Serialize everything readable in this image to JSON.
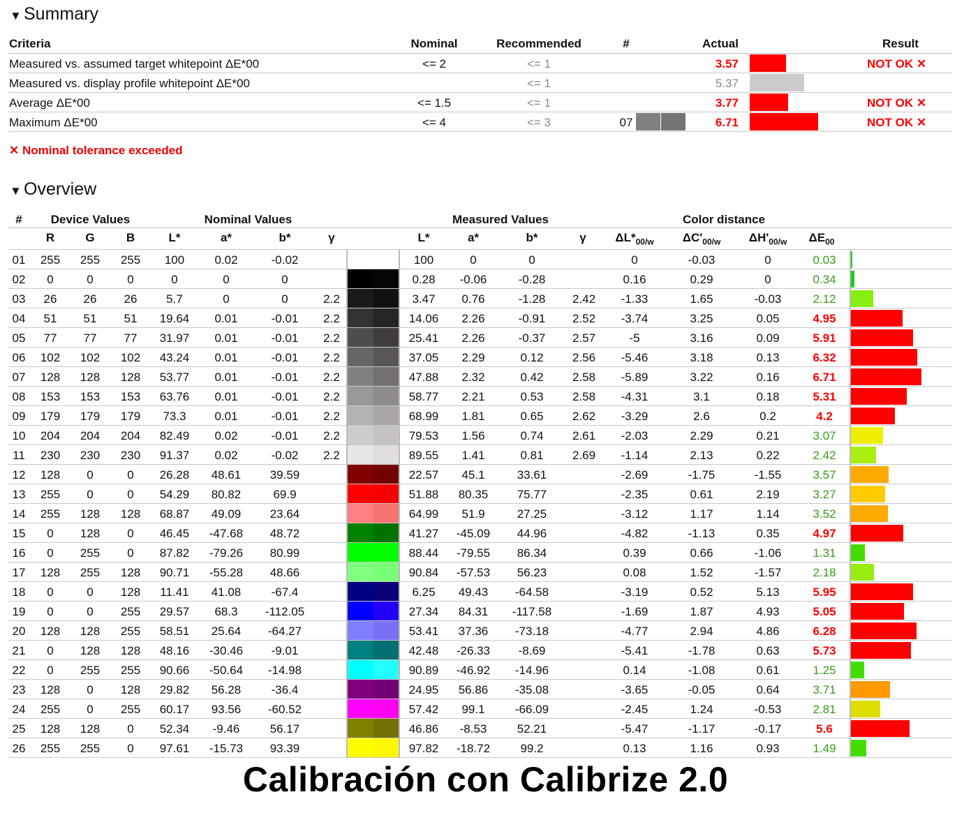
{
  "summary": {
    "title": "Summary",
    "headers": {
      "criteria": "Criteria",
      "nominal": "Nominal",
      "recommended": "Recommended",
      "hash": "#",
      "actual": "Actual",
      "result": "Result"
    },
    "rows": [
      {
        "criteria": "Measured vs. assumed target whitepoint ΔE*00",
        "nominal": "<= 2",
        "recommended": "<= 1",
        "hash": "",
        "actual": "3.57",
        "result": "NOT OK ✕",
        "status": "fail",
        "bar_color": "#ff0000"
      },
      {
        "criteria": "Measured vs. display profile whitepoint ΔE*00",
        "nominal": "",
        "recommended": "<= 1",
        "hash": "",
        "actual": "5.37",
        "result": "",
        "status": "info",
        "bar_color": "#cccccc"
      },
      {
        "criteria": "Average ΔE*00",
        "nominal": "<= 1.5",
        "recommended": "<= 1",
        "hash": "",
        "actual": "3.77",
        "result": "NOT OK ✕",
        "status": "fail",
        "bar_color": "#ff0000"
      },
      {
        "criteria": "Maximum ΔE*00",
        "nominal": "<= 4",
        "recommended": "<= 3",
        "hash": "07",
        "actual": "6.71",
        "result": "NOT OK ✕",
        "status": "fail",
        "bar_color": "#ff0000"
      }
    ],
    "fail_note": "✕ Nominal tolerance exceeded"
  },
  "overview": {
    "title": "Overview",
    "groups": {
      "hash": "#",
      "device": "Device Values",
      "nominal": "Nominal Values",
      "measured": "Measured Values",
      "distance": "Color distance"
    },
    "cols": {
      "r": "R",
      "g": "G",
      "b": "B",
      "nl": "L*",
      "na": "a*",
      "nb": "b*",
      "ng": "γ",
      "ml": "L*",
      "ma": "a*",
      "mb": "b*",
      "mg": "γ",
      "dl": "ΔL*",
      "dc": "ΔC'",
      "dh": "ΔH'",
      "de": "ΔE",
      "sub_w": "00/w",
      "sub_00": "00"
    },
    "rows": [
      {
        "n": "01",
        "r": "255",
        "g": "255",
        "b": "255",
        "nl": "100",
        "na": "0.02",
        "nb": "-0.02",
        "ng": "",
        "ml": "100",
        "ma": "0",
        "mb": "0",
        "mg": "",
        "dl": "0",
        "dc": "-0.03",
        "dh": "0",
        "de": "0.03",
        "color": "#ffffff",
        "mcolor": "#ffffff",
        "bar": 0.03,
        "barcolor": "#22cc22"
      },
      {
        "n": "02",
        "r": "0",
        "g": "0",
        "b": "0",
        "nl": "0",
        "na": "0",
        "nb": "0",
        "ng": "",
        "ml": "0.28",
        "ma": "-0.06",
        "mb": "-0.28",
        "mg": "",
        "dl": "0.16",
        "dc": "0.29",
        "dh": "0",
        "de": "0.34",
        "color": "#000000",
        "mcolor": "#050505",
        "bar": 0.34,
        "barcolor": "#22cc22"
      },
      {
        "n": "03",
        "r": "26",
        "g": "26",
        "b": "26",
        "nl": "5.7",
        "na": "0",
        "nb": "0",
        "ng": "2.2",
        "ml": "3.47",
        "ma": "0.76",
        "mb": "-1.28",
        "mg": "2.42",
        "dl": "-1.33",
        "dc": "1.65",
        "dh": "-0.03",
        "de": "2.12",
        "color": "#1a1a1a",
        "mcolor": "#111111",
        "bar": 2.12,
        "barcolor": "#88ee11"
      },
      {
        "n": "04",
        "r": "51",
        "g": "51",
        "b": "51",
        "nl": "19.64",
        "na": "0.01",
        "nb": "-0.01",
        "ng": "2.2",
        "ml": "14.06",
        "ma": "2.26",
        "mb": "-0.91",
        "mg": "2.52",
        "dl": "-3.74",
        "dc": "3.25",
        "dh": "0.05",
        "de": "4.95",
        "color": "#333333",
        "mcolor": "#272426",
        "bar": 4.95,
        "barcolor": "#ff0000"
      },
      {
        "n": "05",
        "r": "77",
        "g": "77",
        "b": "77",
        "nl": "31.97",
        "na": "0.01",
        "nb": "-0.01",
        "ng": "2.2",
        "ml": "25.41",
        "ma": "2.26",
        "mb": "-0.37",
        "mg": "2.57",
        "dl": "-5",
        "dc": "3.16",
        "dh": "0.09",
        "de": "5.91",
        "color": "#4d4d4d",
        "mcolor": "#403c3e",
        "bar": 5.91,
        "barcolor": "#ff0000"
      },
      {
        "n": "06",
        "r": "102",
        "g": "102",
        "b": "102",
        "nl": "43.24",
        "na": "0.01",
        "nb": "-0.01",
        "ng": "2.2",
        "ml": "37.05",
        "ma": "2.29",
        "mb": "0.12",
        "mg": "2.56",
        "dl": "-5.46",
        "dc": "3.18",
        "dh": "0.13",
        "de": "6.32",
        "color": "#666666",
        "mcolor": "#5a5658",
        "bar": 6.32,
        "barcolor": "#ff0000"
      },
      {
        "n": "07",
        "r": "128",
        "g": "128",
        "b": "128",
        "nl": "53.77",
        "na": "0.01",
        "nb": "-0.01",
        "ng": "2.2",
        "ml": "47.88",
        "ma": "2.32",
        "mb": "0.42",
        "mg": "2.58",
        "dl": "-5.89",
        "dc": "3.22",
        "dh": "0.16",
        "de": "6.71",
        "color": "#808080",
        "mcolor": "#747072",
        "bar": 6.71,
        "barcolor": "#ff0000"
      },
      {
        "n": "08",
        "r": "153",
        "g": "153",
        "b": "153",
        "nl": "63.76",
        "na": "0.01",
        "nb": "-0.01",
        "ng": "2.2",
        "ml": "58.77",
        "ma": "2.21",
        "mb": "0.53",
        "mg": "2.58",
        "dl": "-4.31",
        "dc": "3.1",
        "dh": "0.18",
        "de": "5.31",
        "color": "#999999",
        "mcolor": "#8f8b8c",
        "bar": 5.31,
        "barcolor": "#ff0000"
      },
      {
        "n": "09",
        "r": "179",
        "g": "179",
        "b": "179",
        "nl": "73.3",
        "na": "0.01",
        "nb": "-0.01",
        "ng": "2.2",
        "ml": "68.99",
        "ma": "1.81",
        "mb": "0.65",
        "mg": "2.62",
        "dl": "-3.29",
        "dc": "2.6",
        "dh": "0.2",
        "de": "4.2",
        "color": "#b3b3b3",
        "mcolor": "#aaa6a7",
        "bar": 4.2,
        "barcolor": "#ff0000"
      },
      {
        "n": "10",
        "r": "204",
        "g": "204",
        "b": "204",
        "nl": "82.49",
        "na": "0.02",
        "nb": "-0.01",
        "ng": "2.2",
        "ml": "79.53",
        "ma": "1.56",
        "mb": "0.74",
        "mg": "2.61",
        "dl": "-2.03",
        "dc": "2.29",
        "dh": "0.21",
        "de": "3.07",
        "color": "#cccccc",
        "mcolor": "#c6c2c3",
        "bar": 3.07,
        "barcolor": "#eeee00"
      },
      {
        "n": "11",
        "r": "230",
        "g": "230",
        "b": "230",
        "nl": "91.37",
        "na": "0.02",
        "nb": "-0.02",
        "ng": "2.2",
        "ml": "89.55",
        "ma": "1.41",
        "mb": "0.81",
        "mg": "2.69",
        "dl": "-1.14",
        "dc": "2.13",
        "dh": "0.22",
        "de": "2.42",
        "color": "#e6e6e6",
        "mcolor": "#e1dddd",
        "bar": 2.42,
        "barcolor": "#aaee11"
      },
      {
        "n": "12",
        "r": "128",
        "g": "0",
        "b": "0",
        "nl": "26.28",
        "na": "48.61",
        "nb": "39.59",
        "ng": "",
        "ml": "22.57",
        "ma": "45.1",
        "mb": "33.61",
        "mg": "",
        "dl": "-2.69",
        "dc": "-1.75",
        "dh": "-1.55",
        "de": "3.57",
        "color": "#800000",
        "mcolor": "#720000",
        "bar": 3.57,
        "barcolor": "#ffaa00"
      },
      {
        "n": "13",
        "r": "255",
        "g": "0",
        "b": "0",
        "nl": "54.29",
        "na": "80.82",
        "nb": "69.9",
        "ng": "",
        "ml": "51.88",
        "ma": "80.35",
        "mb": "75.77",
        "mg": "",
        "dl": "-2.35",
        "dc": "0.61",
        "dh": "2.19",
        "de": "3.27",
        "color": "#ff0000",
        "mcolor": "#f80000",
        "bar": 3.27,
        "barcolor": "#ffcc00"
      },
      {
        "n": "14",
        "r": "255",
        "g": "128",
        "b": "128",
        "nl": "68.87",
        "na": "49.09",
        "nb": "23.64",
        "ng": "",
        "ml": "64.99",
        "ma": "51.9",
        "mb": "27.25",
        "mg": "",
        "dl": "-3.12",
        "dc": "1.17",
        "dh": "1.14",
        "de": "3.52",
        "color": "#ff8080",
        "mcolor": "#f87272",
        "bar": 3.52,
        "barcolor": "#ffaa00"
      },
      {
        "n": "15",
        "r": "0",
        "g": "128",
        "b": "0",
        "nl": "46.45",
        "na": "-47.68",
        "nb": "48.72",
        "ng": "",
        "ml": "41.27",
        "ma": "-45.09",
        "mb": "44.96",
        "mg": "",
        "dl": "-4.82",
        "dc": "-1.13",
        "dh": "0.35",
        "de": "4.97",
        "color": "#008000",
        "mcolor": "#007200",
        "bar": 4.97,
        "barcolor": "#ff0000"
      },
      {
        "n": "16",
        "r": "0",
        "g": "255",
        "b": "0",
        "nl": "87.82",
        "na": "-79.26",
        "nb": "80.99",
        "ng": "",
        "ml": "88.44",
        "ma": "-79.55",
        "mb": "86.34",
        "mg": "",
        "dl": "0.39",
        "dc": "0.66",
        "dh": "-1.06",
        "de": "1.31",
        "color": "#00ff00",
        "mcolor": "#00ff00",
        "bar": 1.31,
        "barcolor": "#44dd00"
      },
      {
        "n": "17",
        "r": "128",
        "g": "255",
        "b": "128",
        "nl": "90.71",
        "na": "-55.28",
        "nb": "48.66",
        "ng": "",
        "ml": "90.84",
        "ma": "-57.53",
        "mb": "56.23",
        "mg": "",
        "dl": "0.08",
        "dc": "1.52",
        "dh": "-1.57",
        "de": "2.18",
        "color": "#80ff80",
        "mcolor": "#7bff77",
        "bar": 2.18,
        "barcolor": "#99ee11"
      },
      {
        "n": "18",
        "r": "0",
        "g": "0",
        "b": "128",
        "nl": "11.41",
        "na": "41.08",
        "nb": "-67.4",
        "ng": "",
        "ml": "6.25",
        "ma": "49.43",
        "mb": "-64.58",
        "mg": "",
        "dl": "-3.19",
        "dc": "0.52",
        "dh": "5.13",
        "de": "5.95",
        "color": "#000080",
        "mcolor": "#0a0077",
        "bar": 5.95,
        "barcolor": "#ff0000"
      },
      {
        "n": "19",
        "r": "0",
        "g": "0",
        "b": "255",
        "nl": "29.57",
        "na": "68.3",
        "nb": "-112.05",
        "ng": "",
        "ml": "27.34",
        "ma": "84.31",
        "mb": "-117.58",
        "mg": "",
        "dl": "-1.69",
        "dc": "1.87",
        "dh": "4.93",
        "de": "5.05",
        "color": "#0000ff",
        "mcolor": "#2200f5",
        "bar": 5.05,
        "barcolor": "#ff0000"
      },
      {
        "n": "20",
        "r": "128",
        "g": "128",
        "b": "255",
        "nl": "58.51",
        "na": "25.64",
        "nb": "-64.27",
        "ng": "",
        "ml": "53.41",
        "ma": "37.36",
        "mb": "-73.18",
        "mg": "",
        "dl": "-4.77",
        "dc": "2.94",
        "dh": "4.86",
        "de": "6.28",
        "color": "#8080ff",
        "mcolor": "#7a70f5",
        "bar": 6.28,
        "barcolor": "#ff0000"
      },
      {
        "n": "21",
        "r": "0",
        "g": "128",
        "b": "128",
        "nl": "48.16",
        "na": "-30.46",
        "nb": "-9.01",
        "ng": "",
        "ml": "42.48",
        "ma": "-26.33",
        "mb": "-8.69",
        "mg": "",
        "dl": "-5.41",
        "dc": "-1.78",
        "dh": "0.63",
        "de": "5.73",
        "color": "#008080",
        "mcolor": "#007072",
        "bar": 5.73,
        "barcolor": "#ff0000"
      },
      {
        "n": "22",
        "r": "0",
        "g": "255",
        "b": "255",
        "nl": "90.66",
        "na": "-50.64",
        "nb": "-14.98",
        "ng": "",
        "ml": "90.89",
        "ma": "-46.92",
        "mb": "-14.96",
        "mg": "",
        "dl": "0.14",
        "dc": "-1.08",
        "dh": "0.61",
        "de": "1.25",
        "color": "#00ffff",
        "mcolor": "#22ffff",
        "bar": 1.25,
        "barcolor": "#44dd00"
      },
      {
        "n": "23",
        "r": "128",
        "g": "0",
        "b": "128",
        "nl": "29.82",
        "na": "56.28",
        "nb": "-36.4",
        "ng": "",
        "ml": "24.95",
        "ma": "56.86",
        "mb": "-35.08",
        "mg": "",
        "dl": "-3.65",
        "dc": "-0.05",
        "dh": "0.64",
        "de": "3.71",
        "color": "#800080",
        "mcolor": "#740074",
        "bar": 3.71,
        "barcolor": "#ff9900"
      },
      {
        "n": "24",
        "r": "255",
        "g": "0",
        "b": "255",
        "nl": "60.17",
        "na": "93.56",
        "nb": "-60.52",
        "ng": "",
        "ml": "57.42",
        "ma": "99.1",
        "mb": "-66.09",
        "mg": "",
        "dl": "-2.45",
        "dc": "1.24",
        "dh": "-0.53",
        "de": "2.81",
        "color": "#ff00ff",
        "mcolor": "#ff00f0",
        "bar": 2.81,
        "barcolor": "#dddd00"
      },
      {
        "n": "25",
        "r": "128",
        "g": "128",
        "b": "0",
        "nl": "52.34",
        "na": "-9.46",
        "nb": "56.17",
        "ng": "",
        "ml": "46.86",
        "ma": "-8.53",
        "mb": "52.21",
        "mg": "",
        "dl": "-5.47",
        "dc": "-1.17",
        "dh": "-0.17",
        "de": "5.6",
        "color": "#808000",
        "mcolor": "#727000",
        "bar": 5.6,
        "barcolor": "#ff0000"
      },
      {
        "n": "26",
        "r": "255",
        "g": "255",
        "b": "0",
        "nl": "97.61",
        "na": "-15.73",
        "nb": "93.39",
        "ng": "",
        "ml": "97.82",
        "ma": "-18.72",
        "mb": "99.2",
        "mg": "",
        "dl": "0.13",
        "dc": "1.16",
        "dh": "0.93",
        "de": "1.49",
        "color": "#ffff00",
        "mcolor": "#fff700",
        "bar": 1.49,
        "barcolor": "#44dd00"
      }
    ]
  },
  "footer": "Calibración con Calibrize 2.0"
}
